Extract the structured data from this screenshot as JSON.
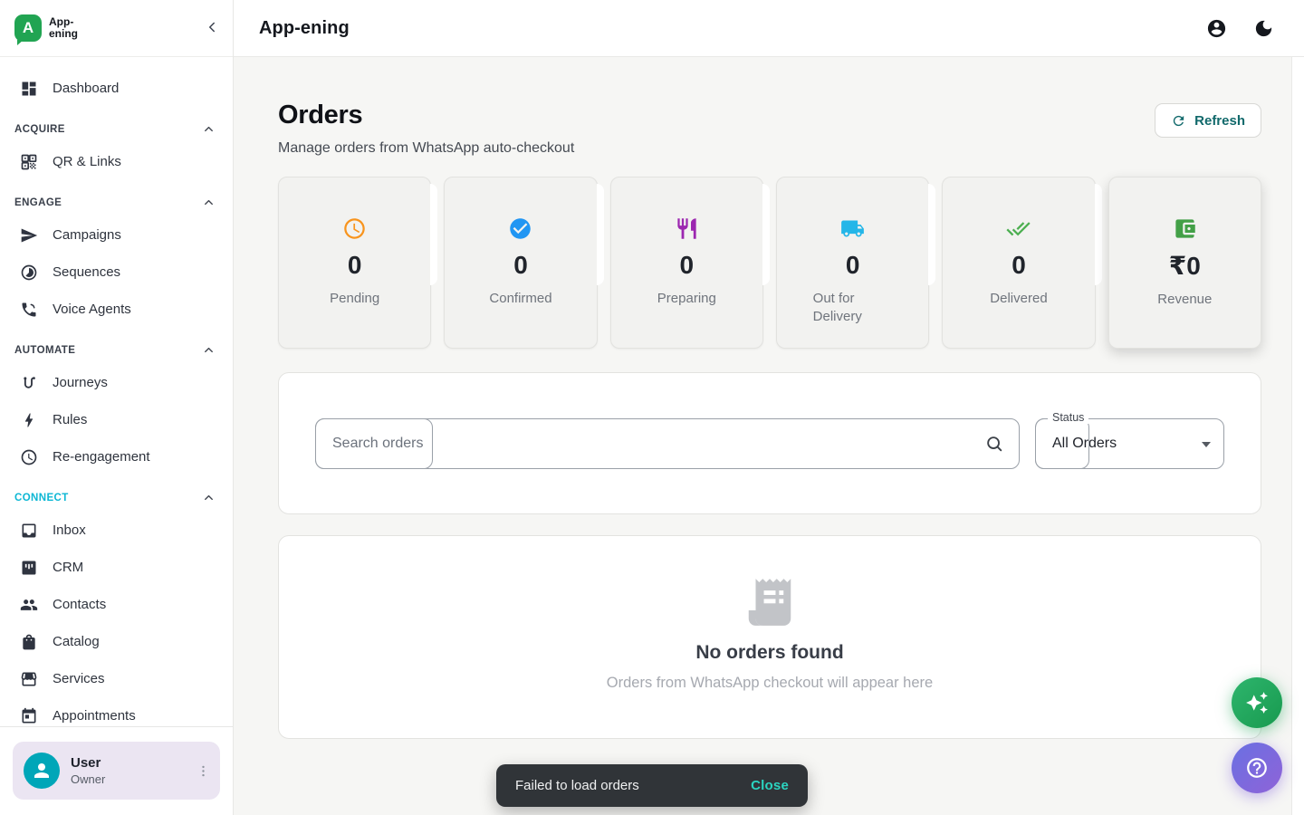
{
  "sidebar": {
    "logo": {
      "letter": "A",
      "line1": "App-",
      "line2": "ening"
    },
    "primary": {
      "label": "Dashboard",
      "icon": "dashboard-icon"
    },
    "sections": [
      {
        "label": "ACQUIRE",
        "accent": false,
        "items": [
          {
            "label": "QR & Links",
            "icon": "qr-code-icon"
          }
        ]
      },
      {
        "label": "ENGAGE",
        "accent": false,
        "items": [
          {
            "label": "Campaigns",
            "icon": "send-icon"
          },
          {
            "label": "Sequences",
            "icon": "sequence-icon"
          },
          {
            "label": "Voice Agents",
            "icon": "voice-agent-icon"
          }
        ]
      },
      {
        "label": "AUTOMATE",
        "accent": false,
        "items": [
          {
            "label": "Journeys",
            "icon": "journey-icon"
          },
          {
            "label": "Rules",
            "icon": "bolt-icon"
          },
          {
            "label": "Re-engagement",
            "icon": "clock-icon"
          }
        ]
      },
      {
        "label": "CONNECT",
        "accent": true,
        "accent_color": "#0cb7d4",
        "items": [
          {
            "label": "Inbox",
            "icon": "inbox-icon"
          },
          {
            "label": "CRM",
            "icon": "kanban-icon"
          },
          {
            "label": "Contacts",
            "icon": "people-icon"
          },
          {
            "label": "Catalog",
            "icon": "shopping-bag-icon"
          },
          {
            "label": "Services",
            "icon": "storefront-icon"
          },
          {
            "label": "Appointments",
            "icon": "calendar-icon"
          }
        ]
      }
    ],
    "user": {
      "name": "User",
      "role": "Owner"
    }
  },
  "header": {
    "title": "App-ening"
  },
  "page": {
    "title": "Orders",
    "subtitle": "Manage orders from WhatsApp auto-checkout",
    "refresh_label": "Refresh"
  },
  "stats": [
    {
      "value": "0",
      "label": "Pending",
      "icon": "clock-icon",
      "color": "#f8941d"
    },
    {
      "value": "0",
      "label": "Confirmed",
      "icon": "check-circle-icon",
      "color": "#2196f3"
    },
    {
      "value": "0",
      "label": "Preparing",
      "icon": "restaurant-icon",
      "color": "#9c27b0"
    },
    {
      "value": "0",
      "label": "Out for Delivery",
      "icon": "truck-icon",
      "color": "#24b6e8",
      "wrap": true
    },
    {
      "value": "0",
      "label": "Delivered",
      "icon": "done-all-icon",
      "color": "#4caf50"
    },
    {
      "value": "₹0",
      "label": "Revenue",
      "icon": "wallet-icon",
      "color": "#43a047",
      "elevated": true
    }
  ],
  "filters": {
    "search_placeholder": "Search orders",
    "status_label": "Status",
    "status_value": "All Orders"
  },
  "empty_state": {
    "title": "No orders found",
    "subtitle": "Orders from WhatsApp checkout will appear here"
  },
  "toast": {
    "message": "Failed to load orders",
    "action_label": "Close"
  },
  "colors": {
    "brand_green": "#21a452",
    "accent_teal": "#11696b",
    "connect_cyan": "#0cb7d4",
    "toast_action": "#2bd4c0",
    "avatar_teal": "#00a6b8"
  }
}
